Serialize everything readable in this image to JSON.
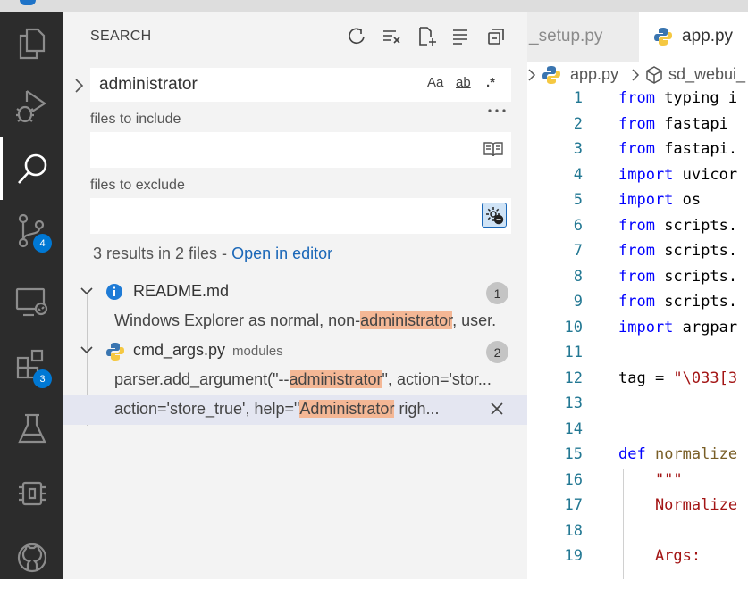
{
  "activity_bar": {
    "items": [
      {
        "name": "explorer",
        "icon": "files-icon"
      },
      {
        "name": "run-debug",
        "icon": "run-debug-icon"
      },
      {
        "name": "search",
        "icon": "search-icon",
        "active": true
      },
      {
        "name": "source-control",
        "icon": "source-control-icon",
        "badge": "4"
      },
      {
        "name": "remote-explorer",
        "icon": "remote-explorer-icon"
      },
      {
        "name": "extensions",
        "icon": "extensions-icon",
        "badge": "3"
      },
      {
        "name": "testing",
        "icon": "flask-icon"
      },
      {
        "name": "chip",
        "icon": "chip-icon"
      },
      {
        "name": "github",
        "icon": "github-icon"
      }
    ]
  },
  "search": {
    "title": "SEARCH",
    "query": "administrator",
    "toggles": {
      "match_case": "Aa",
      "whole_word": "ab",
      "regex": ".*"
    },
    "files_to_include_label": "files to include",
    "files_to_include_value": "",
    "files_to_exclude_label": "files to exclude",
    "files_to_exclude_value": "",
    "summary": "3 results in 2 files - ",
    "open_in_editor": "Open in editor",
    "results": [
      {
        "file": "README.md",
        "dir": "",
        "count": "1",
        "matches": [
          {
            "before": "Windows Explorer as normal, non-",
            "match": "administrator",
            "after": ", user."
          }
        ]
      },
      {
        "file": "cmd_args.py",
        "dir": "modules",
        "count": "2",
        "matches": [
          {
            "before": "parser.add_argument(\"--",
            "match": "administrator",
            "after": "\", action='stor..."
          },
          {
            "before": "action='store_true', help=\"",
            "match": "Administrator",
            "after": " righ..."
          }
        ]
      }
    ]
  },
  "editor": {
    "tabs": [
      {
        "label": "_setup.py",
        "active": false
      },
      {
        "label": "app.py",
        "active": true
      }
    ],
    "breadcrumb": [
      "app.py",
      "sd_webui_"
    ],
    "lines": [
      {
        "n": "1",
        "tokens": [
          {
            "t": "from",
            "c": "kw"
          },
          {
            "t": " typing i",
            "c": ""
          }
        ]
      },
      {
        "n": "2",
        "tokens": [
          {
            "t": "from",
            "c": "kw"
          },
          {
            "t": " fastapi ",
            "c": ""
          }
        ]
      },
      {
        "n": "3",
        "tokens": [
          {
            "t": "from",
            "c": "kw"
          },
          {
            "t": " fastapi.",
            "c": ""
          }
        ]
      },
      {
        "n": "4",
        "tokens": [
          {
            "t": "import",
            "c": "kw"
          },
          {
            "t": " uvicor",
            "c": ""
          }
        ]
      },
      {
        "n": "5",
        "tokens": [
          {
            "t": "import",
            "c": "kw"
          },
          {
            "t": " os",
            "c": ""
          }
        ]
      },
      {
        "n": "6",
        "tokens": [
          {
            "t": "from",
            "c": "kw"
          },
          {
            "t": " scripts.",
            "c": ""
          }
        ]
      },
      {
        "n": "7",
        "tokens": [
          {
            "t": "from",
            "c": "kw"
          },
          {
            "t": " scripts.",
            "c": ""
          }
        ]
      },
      {
        "n": "8",
        "tokens": [
          {
            "t": "from",
            "c": "kw"
          },
          {
            "t": " scripts.",
            "c": ""
          }
        ]
      },
      {
        "n": "9",
        "tokens": [
          {
            "t": "from",
            "c": "kw"
          },
          {
            "t": " scripts.",
            "c": ""
          }
        ]
      },
      {
        "n": "10",
        "tokens": [
          {
            "t": "import",
            "c": "kw"
          },
          {
            "t": " argpar",
            "c": ""
          }
        ]
      },
      {
        "n": "11",
        "tokens": []
      },
      {
        "n": "12",
        "tokens": [
          {
            "t": "tag = ",
            "c": ""
          },
          {
            "t": "\"\\033[3",
            "c": "str"
          }
        ]
      },
      {
        "n": "13",
        "tokens": []
      },
      {
        "n": "14",
        "tokens": []
      },
      {
        "n": "15",
        "tokens": [
          {
            "t": "def",
            "c": "kw"
          },
          {
            "t": " ",
            "c": ""
          },
          {
            "t": "normalize",
            "c": "fn"
          }
        ]
      },
      {
        "n": "16",
        "tokens": [
          {
            "t": "    \"\"\"",
            "c": "str"
          }
        ]
      },
      {
        "n": "17",
        "tokens": [
          {
            "t": "    Normalize",
            "c": "str"
          }
        ]
      },
      {
        "n": "18",
        "tokens": []
      },
      {
        "n": "19",
        "tokens": [
          {
            "t": "    Args:",
            "c": "str"
          }
        ]
      }
    ]
  },
  "colors": {
    "activity_bar": "#2c2c2c",
    "sidebar": "#f3f3f3",
    "badge": "#0078d4",
    "match_highlight": "#f4b795",
    "link": "#1a67b8",
    "keyword": "#0000ff",
    "string": "#a31515",
    "function": "#795e26",
    "line_number": "#237893"
  }
}
